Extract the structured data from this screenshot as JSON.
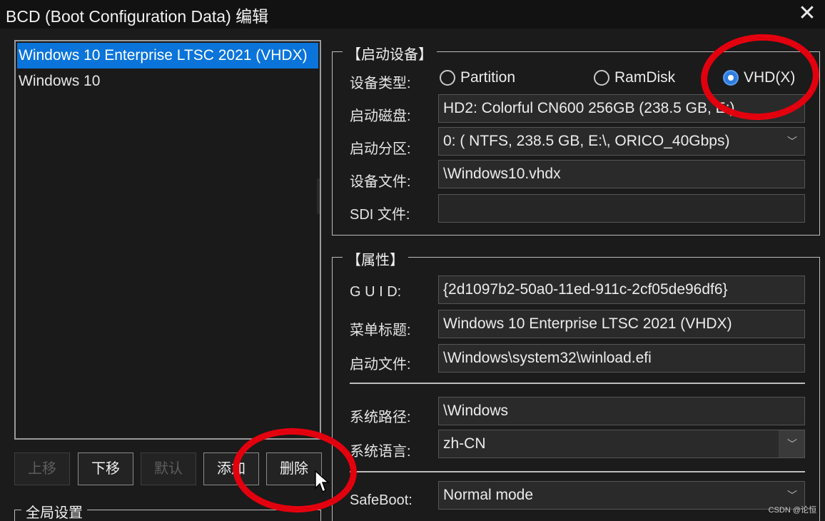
{
  "window": {
    "title": "BCD (Boot Configuration Data) 编辑",
    "close_glyph": "✕"
  },
  "entries": {
    "items": [
      {
        "label": "Windows 10 Enterprise LTSC 2021 (VHDX)",
        "selected": true
      },
      {
        "label": "Windows 10",
        "selected": false
      }
    ]
  },
  "buttons": {
    "move_up": "上移",
    "move_down": "下移",
    "default": "默认",
    "add": "添加",
    "delete": "删除"
  },
  "global_settings": {
    "title": "全局设置"
  },
  "boot_device": {
    "title": "【启动设备】",
    "device_type_label": "设备类型:",
    "device_type_options": [
      "Partition",
      "RamDisk",
      "VHD(X)"
    ],
    "device_type_selected": "VHD(X)",
    "boot_disk_label": "启动磁盘:",
    "boot_disk_value": "HD2: Colorful CN600 256GB (238.5 GB, E:)",
    "boot_partition_label": "启动分区:",
    "boot_partition_value": "0: ( NTFS, 238.5 GB, E:\\, ORICO_40Gbps)",
    "device_file_label": "设备文件:",
    "device_file_value": "\\Windows10.vhdx",
    "sdi_file_label": "SDI 文件:",
    "sdi_file_value": ""
  },
  "properties": {
    "title": "【属性】",
    "guid_label": "G U I D:",
    "guid_value": "{2d1097b2-50a0-11ed-911c-2cf05de96df6}",
    "menu_title_label": "菜单标题:",
    "menu_title_value": "Windows 10 Enterprise LTSC 2021 (VHDX)",
    "boot_file_label": "启动文件:",
    "boot_file_value": "\\Windows\\system32\\winload.efi",
    "system_path_label": "系统路径:",
    "system_path_value": "\\Windows",
    "system_language_label": "系统语言:",
    "system_language_value": "zh-CN",
    "safeboot_label": "SafeBoot:",
    "safeboot_value": "Normal mode"
  },
  "watermark": "CSDN @论恒",
  "colors": {
    "accent": "#0a74da",
    "annotation_red": "#e3000e",
    "background": "#1b1b1b"
  }
}
